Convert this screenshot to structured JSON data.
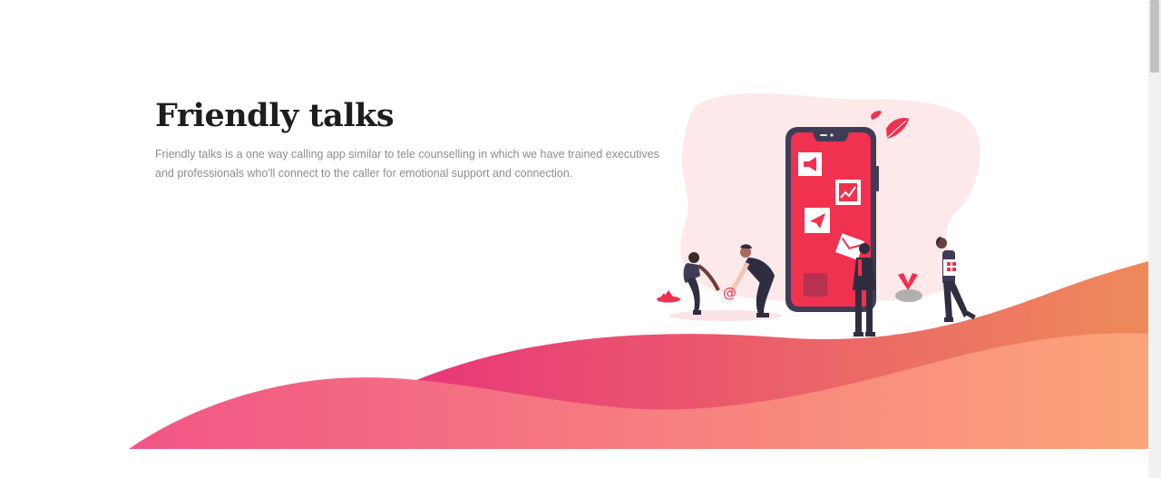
{
  "hero": {
    "title": "Friendly talks",
    "description": "Friendly talks is a one way calling app similar to tele counselling in which we have trained executives and professionals who'll connect to the caller for emotional support and connection."
  },
  "illustration": {
    "phone_icons": [
      "megaphone-icon",
      "chart-icon",
      "paper-plane-icon",
      "envelope-icon"
    ],
    "at_symbol": "@"
  },
  "colors": {
    "accent": "#f0314f",
    "phone_frame": "#3f3d56",
    "blob": "#fde8ea",
    "wave_back_start": "#e8367a",
    "wave_back_end": "#ee8a5a",
    "wave_front_start": "#f15586",
    "wave_front_end": "#fca57a",
    "title": "#1d1d1f",
    "body_text": "#8d8d93"
  }
}
